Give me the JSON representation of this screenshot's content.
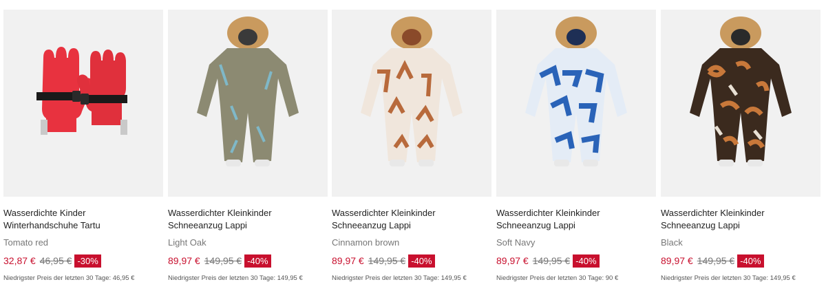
{
  "products": [
    {
      "image_icon": "gloves-image",
      "title_line1": "Wasserdichte Kinder",
      "title_line2": "Winterhandschuhe Tartu",
      "color": "Tomato red",
      "price": "32,87 €",
      "old_price": "46,95 €",
      "discount": "-30%",
      "lowest_price_note": "Niedrigster Preis der letzten 30 Tage: 46,95 €",
      "main_color": "#e8323f"
    },
    {
      "image_icon": "snowsuit-image",
      "title_line1": "Wasserdichter Kleinkinder",
      "title_line2": "Schneeanzug Lappi",
      "color": "Light Oak",
      "price": "89,97 €",
      "old_price": "149,95 €",
      "discount": "-40%",
      "lowest_price_note": "Niedrigster Preis der letzten 30 Tage: 149,95 €",
      "main_color": "#8c8a72"
    },
    {
      "image_icon": "snowsuit-image",
      "title_line1": "Wasserdichter Kleinkinder",
      "title_line2": "Schneeanzug Lappi",
      "color": "Cinnamon brown",
      "price": "89,97 €",
      "old_price": "149,95 €",
      "discount": "-40%",
      "lowest_price_note": "Niedrigster Preis der letzten 30 Tage: 149,95 €",
      "main_color": "#b86a3c"
    },
    {
      "image_icon": "snowsuit-image",
      "title_line1": "Wasserdichter Kleinkinder",
      "title_line2": "Schneeanzug Lappi",
      "color": "Soft Navy",
      "price": "89,97 €",
      "old_price": "149,95 €",
      "discount": "-40%",
      "lowest_price_note": "Niedrigster Preis der letzten 30 Tage: 90 €",
      "main_color": "#2a63b8"
    },
    {
      "image_icon": "snowsuit-image",
      "title_line1": "Wasserdichter Kleinkinder",
      "title_line2": "Schneeanzug Lappi",
      "color": "Black",
      "price": "89,97 €",
      "old_price": "149,95 €",
      "discount": "-40%",
      "lowest_price_note": "Niedrigster Preis der letzten 30 Tage: 149,95 €",
      "main_color": "#5a3a22"
    }
  ]
}
